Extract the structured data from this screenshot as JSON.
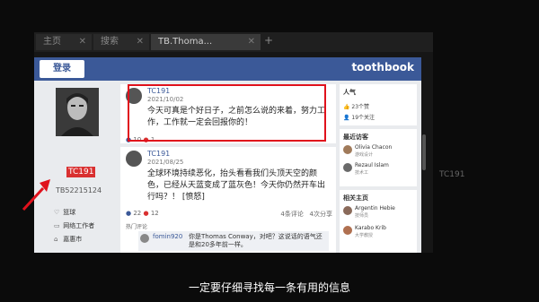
{
  "browser": {
    "tabs": [
      {
        "label": "主页"
      },
      {
        "label": "搜索"
      },
      {
        "label": "TB.Thoma..."
      }
    ],
    "new_tab": "+",
    "background_text": "TC191"
  },
  "site": {
    "login": "登录",
    "brand": "toothbook"
  },
  "profile": {
    "username": "TC191",
    "userid": "TB52215124",
    "info": [
      {
        "icon": "heart-icon",
        "text": "篮球"
      },
      {
        "icon": "briefcase-icon",
        "text": "网络工作者"
      },
      {
        "icon": "home-icon",
        "text": "嘉惠市"
      }
    ]
  },
  "posts": [
    {
      "author": "TC191",
      "date": "2021/10/02",
      "text": "今天可真是个好日子，之前怎么说的来着，努力工作，工作就一定会回报你的！",
      "likes": "10",
      "loves": "1"
    },
    {
      "author": "TC191",
      "date": "2021/08/25",
      "text": "全球环境持续恶化，抬头看看我们头顶天空的颜色，已经从天蓝变成了蓝灰色！今天你仍然开车出行吗？！ [愤怒]",
      "likes": "22",
      "loves": "12",
      "shares": "4条评论",
      "reposts": "4次分享",
      "hot_comments_label": "热门评论",
      "comment": {
        "author": "fomin920",
        "text": "你是Thomas Conway，对吧？这说话的语气还是和20多年前一样。"
      }
    }
  ],
  "sidebar": {
    "popularity": {
      "title": "人气",
      "likes": "23个赞",
      "follows": "19个关注"
    },
    "recent_visitors": {
      "title": "最近访客",
      "items": [
        {
          "name": "Olivia Chacon",
          "sub": "游戏设计"
        },
        {
          "name": "Rezaul Islam",
          "sub": "技术工"
        }
      ]
    },
    "related": {
      "title": "相关主页",
      "items": [
        {
          "name": "Argentin Hebie",
          "sub": "技师员"
        },
        {
          "name": "Karabo Krib",
          "sub": "大学教授"
        }
      ]
    }
  },
  "subtitle": "一定要仔细寻找每一条有用的信息"
}
